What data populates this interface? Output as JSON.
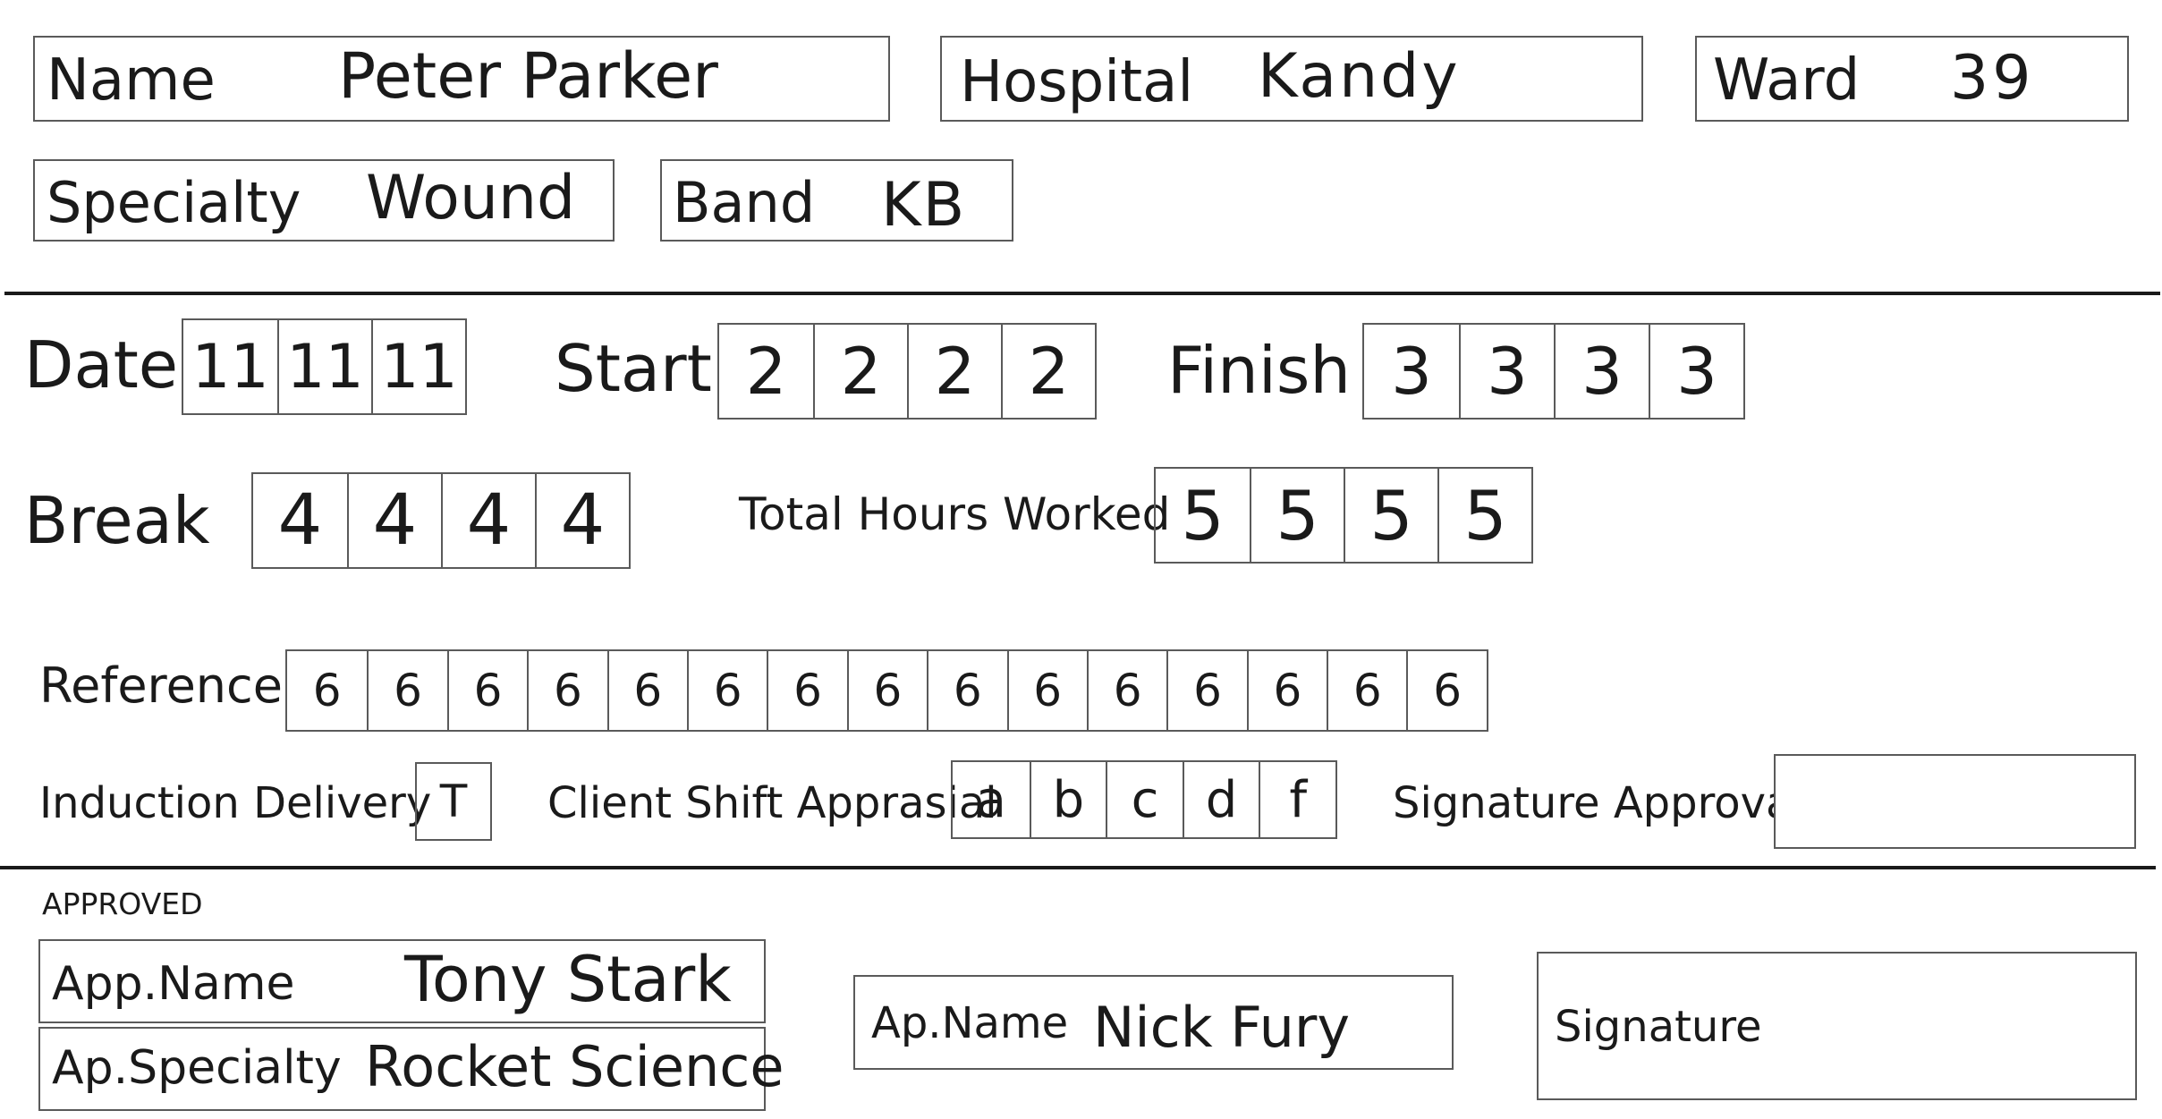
{
  "personal": {
    "name_label": "Name",
    "name_value": "Peter Parker",
    "hospital_label": "Hospital",
    "hospital_value": "Kandy",
    "ward_label": "Ward",
    "ward_value": "39",
    "specialty_label": "Specialty",
    "specialty_value": "Wound",
    "band_label": "Band",
    "band_value": "KB"
  },
  "shift": {
    "date_label": "Date",
    "date_cells": [
      "11",
      "11",
      "11"
    ],
    "start_label": "Start",
    "start_cells": [
      "2",
      "2",
      "2",
      "2"
    ],
    "finish_label": "Finish",
    "finish_cells": [
      "3",
      "3",
      "3",
      "3"
    ],
    "break_label": "Break",
    "break_cells": [
      "4",
      "4",
      "4",
      "4"
    ],
    "total_label": "Total Hours Worked",
    "total_cells": [
      "5",
      "5",
      "5",
      "5"
    ],
    "reference_label": "Reference",
    "reference_cells": [
      "6",
      "6",
      "6",
      "6",
      "6",
      "6",
      "6",
      "6",
      "6",
      "6",
      "6",
      "6",
      "6",
      "6",
      "6"
    ],
    "induction_label": "Induction Delivery",
    "induction_cells": [
      "T"
    ],
    "appraisal_label": "Client Shift Apprasial",
    "appraisal_cells": [
      "a",
      "b",
      "c",
      "d",
      "f"
    ],
    "signature_approval_label": "Signature Approval"
  },
  "approved": {
    "heading": "APPROVED",
    "app_name_label": "App.Name",
    "app_name_value": "Tony Stark",
    "ap_specialty_label": "Ap.Specialty",
    "ap_specialty_value": "Rocket Science",
    "ap_name_label": "Ap.Name",
    "ap_name_value": "Nick Fury",
    "signature_label": "Signature"
  }
}
